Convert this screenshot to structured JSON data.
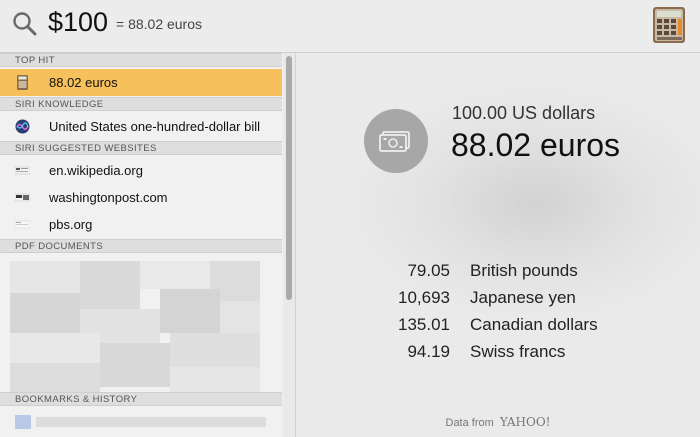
{
  "search": {
    "query": "$100",
    "inline_result": "= 88.02 euros",
    "search_icon": "magnifier-icon",
    "app_icon": "calculator-icon"
  },
  "results": {
    "sections": [
      {
        "header": "TOP HIT",
        "items": [
          {
            "label": "88.02 euros",
            "icon": "calculator-icon",
            "selected": true
          }
        ]
      },
      {
        "header": "SIRI KNOWLEDGE",
        "items": [
          {
            "label": "United States one-hundred-dollar bill",
            "icon": "siri-icon"
          }
        ]
      },
      {
        "header": "SIRI SUGGESTED WEBSITES",
        "items": [
          {
            "label": "en.wikipedia.org",
            "icon": "website-thumbnail-icon"
          },
          {
            "label": "washingtonpost.com",
            "icon": "website-thumbnail-icon"
          },
          {
            "label": "pbs.org",
            "icon": "website-thumbnail-icon"
          }
        ]
      },
      {
        "header": "PDF DOCUMENTS",
        "items": []
      },
      {
        "header": "BOOKMARKS & HISTORY",
        "items": []
      }
    ]
  },
  "preview": {
    "icon": "banknote-icon",
    "source_amount": "100.00 US dollars",
    "target_amount": "88.02 euros",
    "conversions": [
      {
        "value": "79.05",
        "currency": "British pounds"
      },
      {
        "value": "10,693",
        "currency": "Japanese yen"
      },
      {
        "value": "135.01",
        "currency": "Canadian dollars"
      },
      {
        "value": "94.19",
        "currency": "Swiss francs"
      }
    ],
    "footer_prefix": "Data from",
    "footer_brand": "YAHOO!"
  },
  "colors": {
    "selection": "#f6c05a",
    "section_header_bg": "#dedede",
    "preview_circle": "#a7a7a7"
  }
}
